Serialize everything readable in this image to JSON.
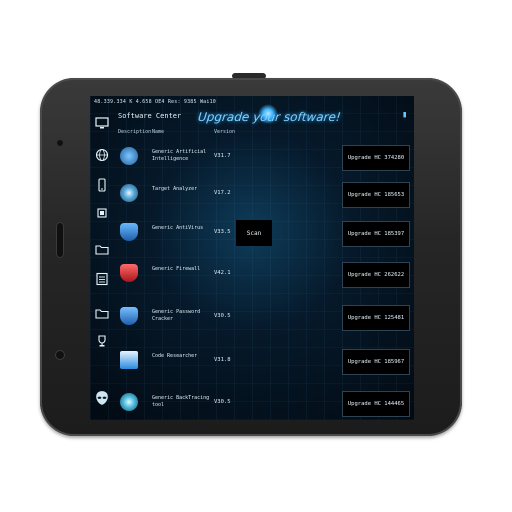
{
  "statusbar": {
    "text": "48.339.334  K   4.658  OE4   Res: 9385   Wai10"
  },
  "header": {
    "banner": "Upgrade your software!",
    "app_title": "Software Center",
    "col_description": "Description",
    "col_name": "Name",
    "col_version": "Version"
  },
  "sidebar": {
    "icons": [
      "monitor-icon",
      "globe-icon",
      "phone-icon",
      "folder-icon",
      "chip-icon",
      "folder-icon",
      "list-icon",
      "folder-icon",
      "trophy-icon",
      "alien-icon"
    ]
  },
  "scan_label": "Scan",
  "rows": [
    {
      "name": "Generic Artificial Intelligence",
      "version": "V31.7",
      "action": "Upgrade HC 374280",
      "icon": "brain-icon",
      "color": "#2c6fb0"
    },
    {
      "name": "Target Analyzer",
      "version": "V17.2",
      "action": "Upgrade HC 185653",
      "icon": "target-icon",
      "color": "#3f7fb6"
    },
    {
      "name": "Generic AntiVirus",
      "version": "V33.5",
      "action": "Upgrade HC 185397",
      "icon": "shield-icon",
      "color": "#3c8fd8"
    },
    {
      "name": "Generic Firewall",
      "version": "V42.1",
      "action": "Upgrade HC 262622",
      "icon": "firewall-shield-icon",
      "color": "#c8262a"
    },
    {
      "name": "Generic Password Cracker",
      "version": "V30.5",
      "action": "Upgrade HC 125481",
      "icon": "key-shield-icon",
      "color": "#2f80d4"
    },
    {
      "name": "Code Researcher",
      "version": "V31.8",
      "action": "Upgrade HC 185967",
      "icon": "download-arrow-icon",
      "color": "#2b8de0"
    },
    {
      "name": "Generic BackTracing tool",
      "version": "V30.5",
      "action": "Upgrade HC 144465",
      "icon": "globe-icon",
      "color": "#3aa0c8"
    }
  ]
}
